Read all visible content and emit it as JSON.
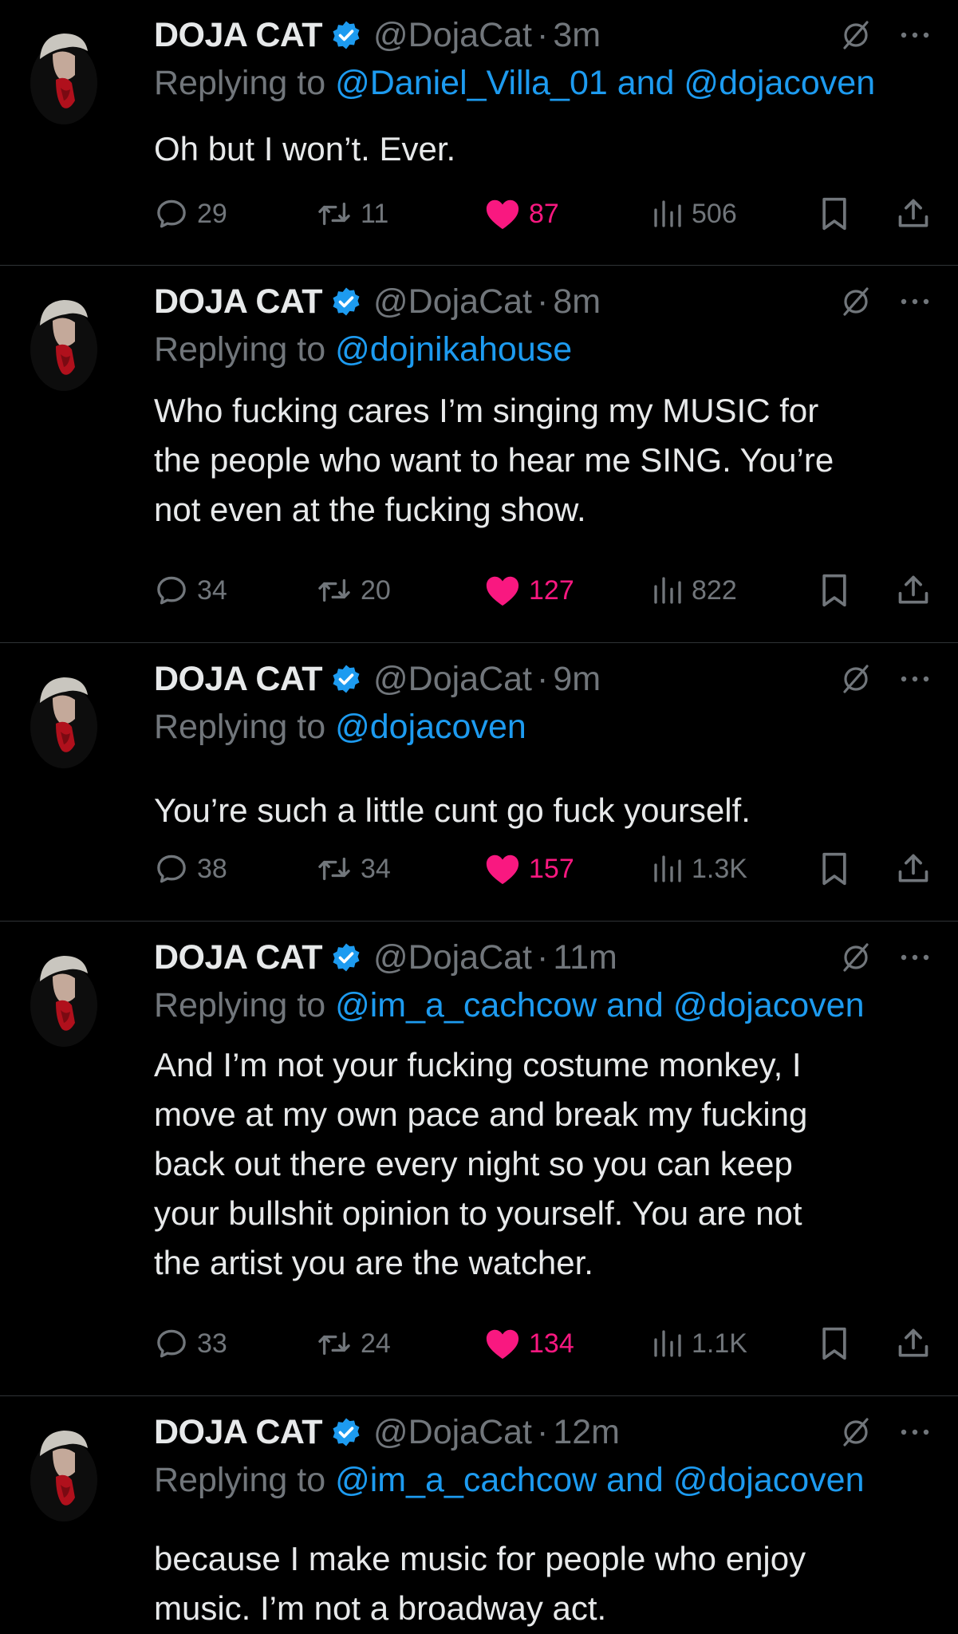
{
  "colors": {
    "background": "#000000",
    "text": "#e7e9ea",
    "muted": "#71767b",
    "mention": "#1d9bf0",
    "like": "#f91880",
    "verified": "#1d9bf0",
    "divider": "#2f3336"
  },
  "icons": {
    "reply": "speech-bubble-icon",
    "retweet": "retweet-icon",
    "like": "heart-icon",
    "views": "bar-chart-icon",
    "bookmark": "bookmark-icon",
    "share": "share-icon",
    "grok": "grok-icon",
    "more": "ellipsis-icon",
    "verified": "verified-badge-icon"
  },
  "tweets": [
    {
      "name": "DOJA CAT",
      "handle": "@DojaCat",
      "dot": "·",
      "time": "3m",
      "reply_prefix": "Replying to",
      "reply_to": "@Daniel_Villa_01 and @dojacoven",
      "text": "Oh but I won’t. Ever.",
      "stats": {
        "replies": "29",
        "retweets": "11",
        "likes": "87",
        "views": "506"
      }
    },
    {
      "name": "DOJA CAT",
      "handle": "@DojaCat",
      "dot": "·",
      "time": "8m",
      "reply_prefix": "Replying to",
      "reply_to": "@dojnikahouse",
      "text": "Who fucking cares I’m singing my MUSIC for\nthe people who want to hear me SING. You’re\nnot even at the fucking show.",
      "stats": {
        "replies": "34",
        "retweets": "20",
        "likes": "127",
        "views": "822"
      }
    },
    {
      "name": "DOJA CAT",
      "handle": "@DojaCat",
      "dot": "·",
      "time": "9m",
      "reply_prefix": "Replying to",
      "reply_to": "@dojacoven",
      "text": "You’re such a little cunt go fuck yourself.",
      "stats": {
        "replies": "38",
        "retweets": "34",
        "likes": "157",
        "views": "1.3K"
      }
    },
    {
      "name": "DOJA CAT",
      "handle": "@DojaCat",
      "dot": "·",
      "time": "11m",
      "reply_prefix": "Replying to",
      "reply_to": "@im_a_cachcow and @dojacoven",
      "text": "And I’m not your fucking costume monkey, I\nmove at my own pace and break my fucking\nback out there every night so you can keep\nyour bullshit opinion to yourself. You are not\nthe artist you are the watcher.",
      "stats": {
        "replies": "33",
        "retweets": "24",
        "likes": "134",
        "views": "1.1K"
      }
    },
    {
      "name": "DOJA CAT",
      "handle": "@DojaCat",
      "dot": "·",
      "time": "12m",
      "reply_prefix": "Replying to",
      "reply_to": "@im_a_cachcow and @dojacoven",
      "text": "because I make music for people who enjoy\nmusic. I’m not a broadway act."
    }
  ]
}
